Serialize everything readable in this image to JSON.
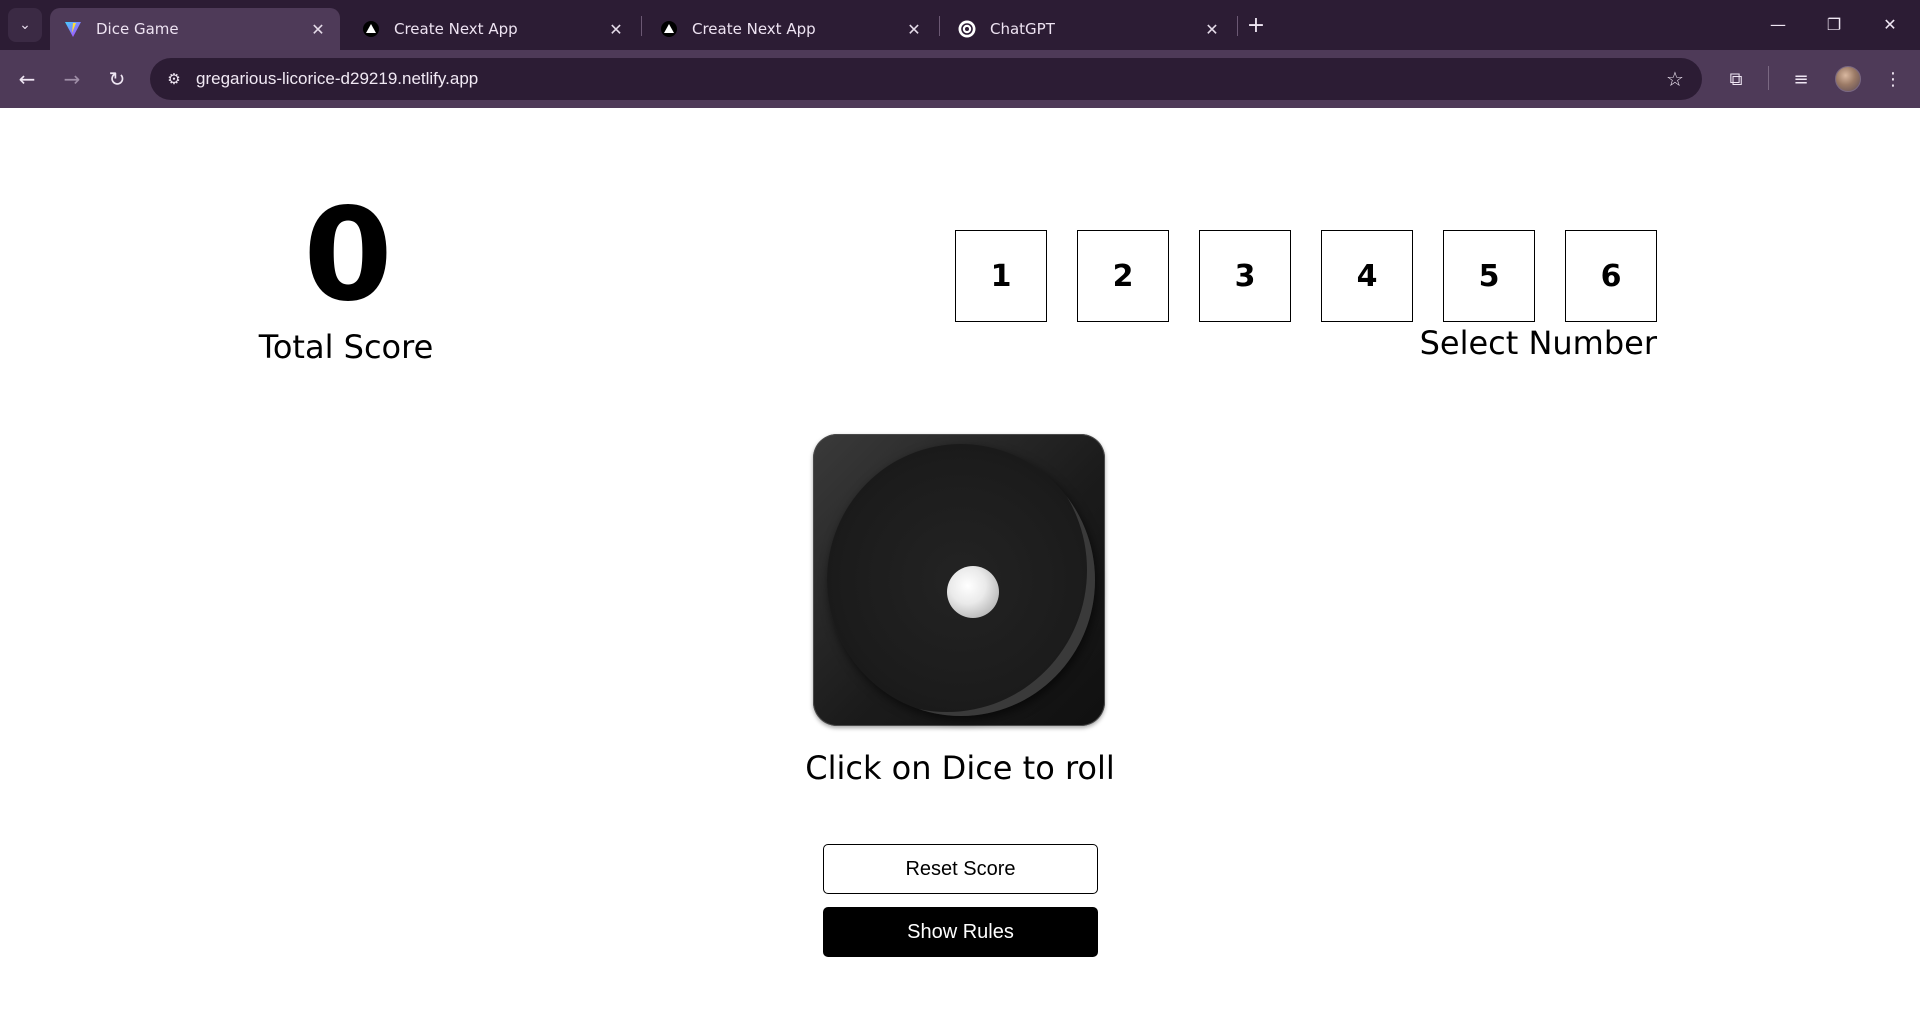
{
  "browser": {
    "tabs": [
      {
        "title": "Dice Game",
        "active": true,
        "favicon": "vite-icon"
      },
      {
        "title": "Create Next App",
        "active": false,
        "favicon": "vercel-triangle-icon"
      },
      {
        "title": "Create Next App",
        "active": false,
        "favicon": "vercel-triangle-icon"
      },
      {
        "title": "ChatGPT",
        "active": false,
        "favicon": "openai-icon"
      }
    ],
    "url": "gregarious-licorice-d29219.netlify.app"
  },
  "game": {
    "total_score": "0",
    "total_score_label": "Total Score",
    "numbers": [
      "1",
      "2",
      "3",
      "4",
      "5",
      "6"
    ],
    "select_label": "Select Number",
    "dice_face": "1",
    "roll_hint": "Click on Dice to roll",
    "reset_label": "Reset Score",
    "rules_label": "Show Rules"
  },
  "colors": {
    "chrome_dark": "#2c1c34",
    "chrome_toolbar": "#4e3a58",
    "text": "#000000",
    "rules_button_bg": "#000000"
  }
}
